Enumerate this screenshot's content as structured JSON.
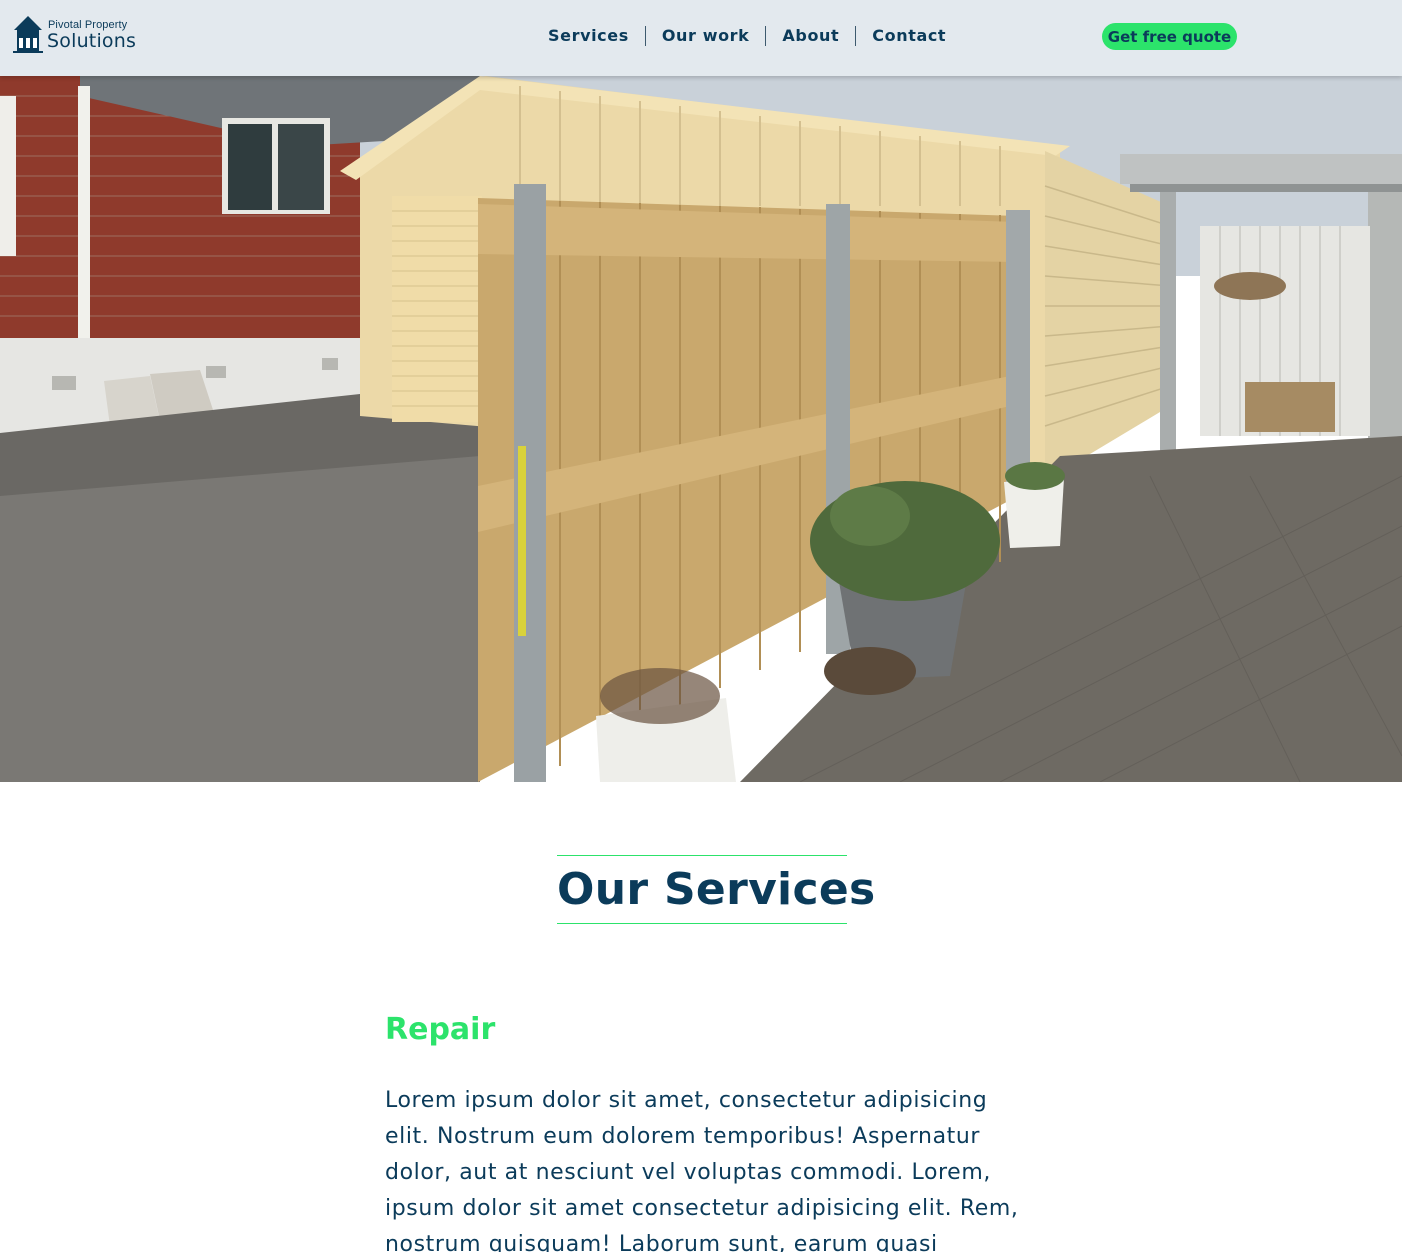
{
  "header": {
    "logo": {
      "small": "Pivotal Property",
      "big": "Solutions",
      "icon": "house-icon"
    },
    "nav": [
      {
        "label": "Services"
      },
      {
        "label": "Our work"
      },
      {
        "label": "About"
      },
      {
        "label": "Contact"
      }
    ],
    "cta_label": "Get free quote"
  },
  "hero": {
    "image": "photo of new timber paling fence beside a cream garage and brick house"
  },
  "services": {
    "title": "Our Services",
    "items": [
      {
        "heading": "Repair",
        "text": "Lorem ipsum dolor sit amet, consectetur adipisicing elit. Nostrum eum dolorem temporibus! Aspernatur dolor, aut at nesciunt vel voluptas commodi. Lorem, ipsum dolor sit amet consectetur adipisicing elit. Rem, nostrum quisquam! Laborum sunt, earum quasi"
      }
    ]
  },
  "colors": {
    "navy": "#0b3b5a",
    "accent_green": "#2ce36b",
    "header_bg": "#e3e9ee"
  }
}
